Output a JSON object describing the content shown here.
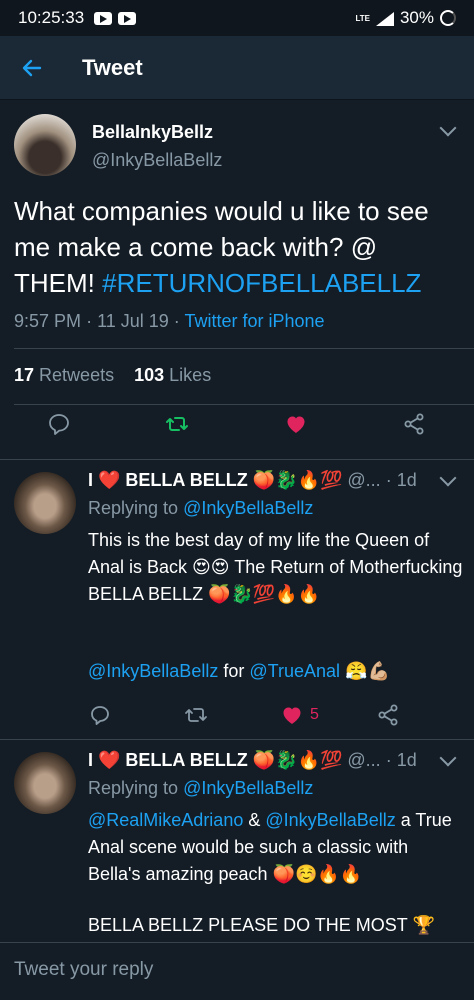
{
  "status_bar": {
    "time": "10:25:33",
    "network": "LTE",
    "battery": "30%"
  },
  "app_bar": {
    "title": "Tweet",
    "back_icon": "arrow-left-icon"
  },
  "main_tweet": {
    "display_name": "BellaInkyBellz",
    "handle": "@InkyBellaBellz",
    "text_part1": "What companies would u like to see me make a come back with? @ THEM! ",
    "hashtag": "#RETURNOFBELLABELLZ",
    "time": "9:57 PM",
    "date": "11 Jul 19",
    "source": "Twitter for iPhone",
    "retweet_count": "17",
    "retweet_label": "Retweets",
    "like_count": "103",
    "like_label": "Likes"
  },
  "replies": [
    {
      "display_name": "I ❤️ BELLA BELLZ 🍑🐉🔥💯",
      "handle": "@...",
      "age": "· 1d",
      "replying_label": "Replying to",
      "replying_to": "@InkyBellaBellz",
      "line1": "This is the best day of my life the Queen of Anal is Back 😍😍 The Return of Motherfucking BELLA BELLZ 🍑🐉💯🔥🔥",
      "mention1": "@InkyBellaBellz",
      "for_label": "for",
      "mention2": "@TrueAnal",
      "mention_tail": "😤💪🏼",
      "like_count": "5"
    },
    {
      "display_name": "I ❤️ BELLA BELLZ 🍑🐉🔥💯",
      "handle": "@...",
      "age": "· 1d",
      "replying_label": "Replying to",
      "replying_to": "@InkyBellaBellz",
      "mention1": "@RealMikeAdriano",
      "amp": "&",
      "mention2": "@InkyBellaBellz",
      "body": "a True Anal scene would be such a classic with Bella's amazing peach 🍑☺️🔥🔥",
      "line2": "BELLA BELLZ PLEASE DO THE MOST 🏆"
    }
  ],
  "compose": {
    "placeholder": "Tweet your reply"
  },
  "colors": {
    "background": "#141d26",
    "accent": "#1da1f2",
    "secondary_text": "#8899a6",
    "retweet_green": "#17bf63",
    "like_red": "#e0245e"
  }
}
